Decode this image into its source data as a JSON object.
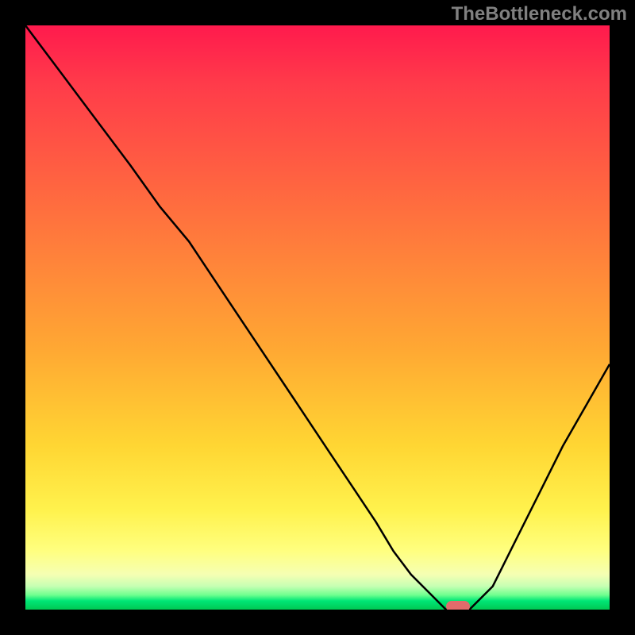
{
  "watermark": "TheBottleneck.com",
  "colors": {
    "frame": "#000000",
    "curve": "#000000",
    "marker": "#e26b6b",
    "gradient_top": "#ff1a4d",
    "gradient_mid": "#ffd633",
    "gradient_bottom": "#00c853"
  },
  "chart_data": {
    "type": "line",
    "title": "",
    "xlabel": "",
    "ylabel": "",
    "xlim": [
      0,
      100
    ],
    "ylim": [
      0,
      100
    ],
    "x": [
      0,
      6,
      12,
      18,
      23,
      28,
      34,
      40,
      46,
      52,
      56,
      60,
      63,
      66,
      70,
      72,
      76,
      80,
      84,
      88,
      92,
      96,
      100
    ],
    "values": [
      100,
      92,
      84,
      76,
      69,
      63,
      54,
      45,
      36,
      27,
      21,
      15,
      10,
      6,
      2,
      0,
      0,
      4,
      12,
      20,
      28,
      35,
      42
    ],
    "marker": {
      "x": 74,
      "y": 0
    },
    "gradient_stops": [
      {
        "pos": 0,
        "color": "#ff1a4d"
      },
      {
        "pos": 55,
        "color": "#ffa733"
      },
      {
        "pos": 90,
        "color": "#ffff80"
      },
      {
        "pos": 100,
        "color": "#00c853"
      }
    ]
  }
}
